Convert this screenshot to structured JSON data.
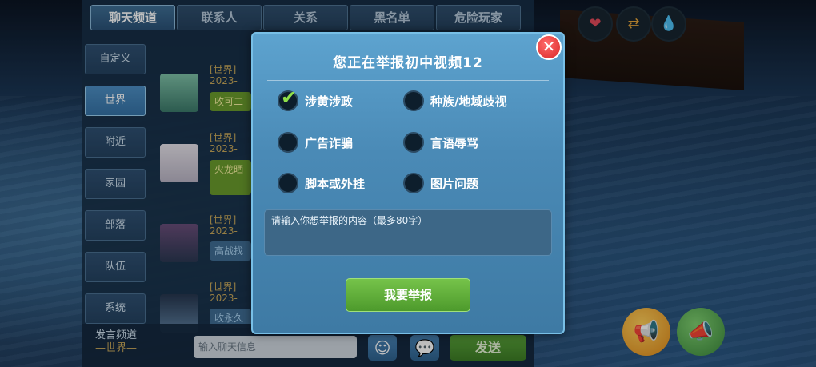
{
  "chat": {
    "tabs": [
      "聊天频道",
      "联系人",
      "关系",
      "黑名单",
      "危险玩家"
    ],
    "sidebar": [
      "自定义",
      "世界",
      "附近",
      "家园",
      "部落",
      "队伍",
      "系统"
    ],
    "messages": [
      {
        "channel": "[世界]",
        "time": "2023-",
        "text": "收可二"
      },
      {
        "channel": "[世界]",
        "time": "2023-",
        "text": "火龙晒"
      },
      {
        "channel": "[世界]",
        "time": "2023-",
        "text": "高战找"
      },
      {
        "channel": "[世界]",
        "time": "2023-",
        "text": "收永久"
      }
    ],
    "channel_label": "发言频道",
    "channel_value": "—世界—",
    "input_placeholder": "输入聊天信息",
    "send_label": "发送"
  },
  "dialog": {
    "title": "您正在举报初中视频12",
    "options": [
      "涉黄涉政",
      "种族/地域歧视",
      "广告诈骗",
      "言语辱骂",
      "脚本或外挂",
      "图片问题"
    ],
    "selected": "涉黄涉政",
    "textarea_placeholder": "请输入你想举报的内容（最多80字）",
    "submit_label": "我要举报",
    "close_glyph": "✕"
  },
  "hud": {
    "icons": [
      "heart-icon",
      "arrows-icon",
      "water-drop-icon"
    ],
    "glyphs": [
      "❤",
      "⇄",
      "💧"
    ]
  },
  "colors": {
    "accent_green": "#5aa33a",
    "dialog_blue": "#4a8ab6",
    "close_red": "#d92727",
    "check_green": "#8fe04a"
  }
}
